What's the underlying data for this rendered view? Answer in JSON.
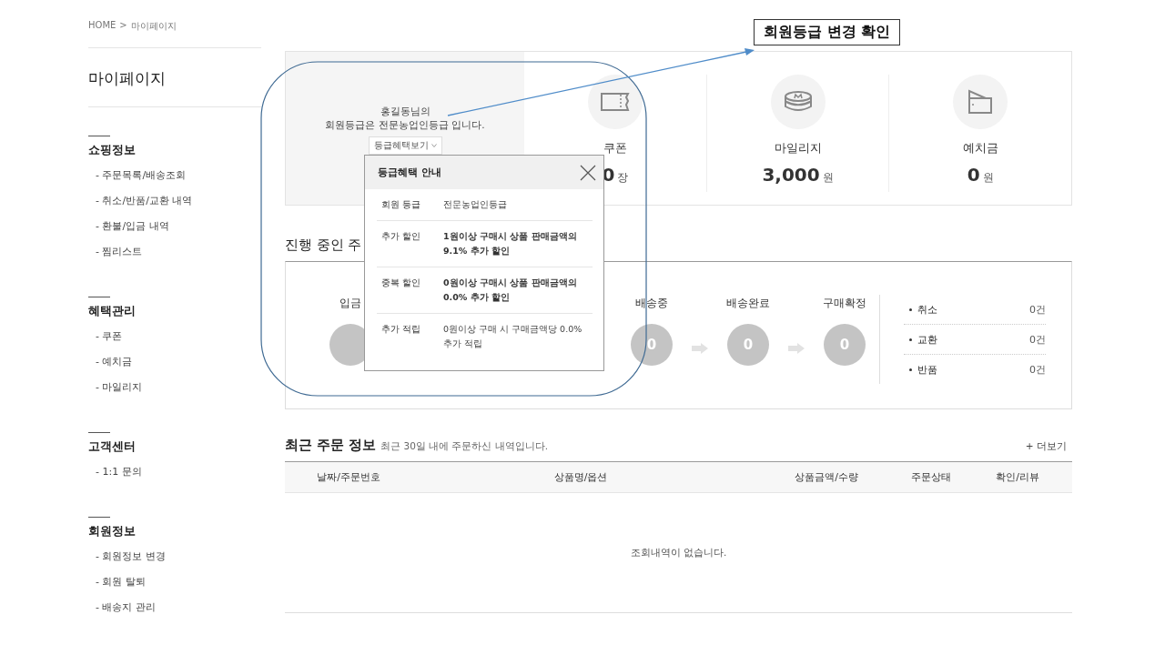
{
  "breadcrumb": {
    "home": "HOME",
    "separator": ">",
    "current": "마이페이지"
  },
  "sidebar": {
    "title": "마이페이지",
    "sections": [
      {
        "heading": "쇼핑정보",
        "items": [
          "- 주문목록/배송조회",
          "- 취소/반품/교환 내역",
          "- 환불/입금 내역",
          "- 찜리스트"
        ]
      },
      {
        "heading": "혜택관리",
        "items": [
          "- 쿠폰",
          "- 예치금",
          "- 마일리지"
        ]
      },
      {
        "heading": "고객센터",
        "items": [
          "- 1:1 문의"
        ]
      },
      {
        "heading": "회원정보",
        "items": [
          "- 회원정보 변경",
          "- 회원 탈퇴",
          "- 배송지 관리"
        ]
      }
    ]
  },
  "grade_panel": {
    "name_line": "홍길동님의",
    "grade_line": "회원등급은 전문농업인등급 입니다.",
    "benefit_button": "등급혜택보기"
  },
  "summary": [
    {
      "kind": "coupon",
      "label": "쿠폰",
      "value": "0",
      "unit": "장"
    },
    {
      "kind": "mileage",
      "label": "마일리지",
      "value": "3,000",
      "unit": "원"
    },
    {
      "kind": "deposit",
      "label": "예치금",
      "value": "0",
      "unit": "원"
    }
  ],
  "order_status": {
    "title": "진행 중인 주",
    "steps": [
      {
        "label": "입금"
      },
      {
        "label": "배송중",
        "count": "0"
      },
      {
        "label": "배송완료",
        "count": "0"
      },
      {
        "label": "구매확정",
        "count": "0"
      }
    ],
    "claims": [
      {
        "label": "취소",
        "count": "0건"
      },
      {
        "label": "교환",
        "count": "0건"
      },
      {
        "label": "반품",
        "count": "0건"
      }
    ]
  },
  "recent_orders": {
    "title": "최근 주문 정보",
    "subtitle": "최근 30일 내에 주문하신 내역입니다.",
    "more": "+ 더보기",
    "columns": [
      "날짜/주문번호",
      "상품명/옵션",
      "상품금액/수량",
      "주문상태",
      "확인/리뷰"
    ],
    "empty": "조회내역이 없습니다."
  },
  "benefit_popup": {
    "title": "등급혜택 안내",
    "rows": [
      {
        "label": "회원 등급",
        "value": "전문농업인등급"
      },
      {
        "label": "추가 할인",
        "value": "1원이상 구매시 상품 판매금액의 9.1% 추가 할인"
      },
      {
        "label": "중복 할인",
        "value": "0원이상 구매시 상품 판매금액의 0.0% 추가 할인"
      },
      {
        "label": "추가 적립",
        "value": "0원이상 구매 시 구매금액당 0.0% 추가 적립"
      }
    ]
  },
  "annotation": {
    "callout": "회원등급 변경 확인"
  }
}
